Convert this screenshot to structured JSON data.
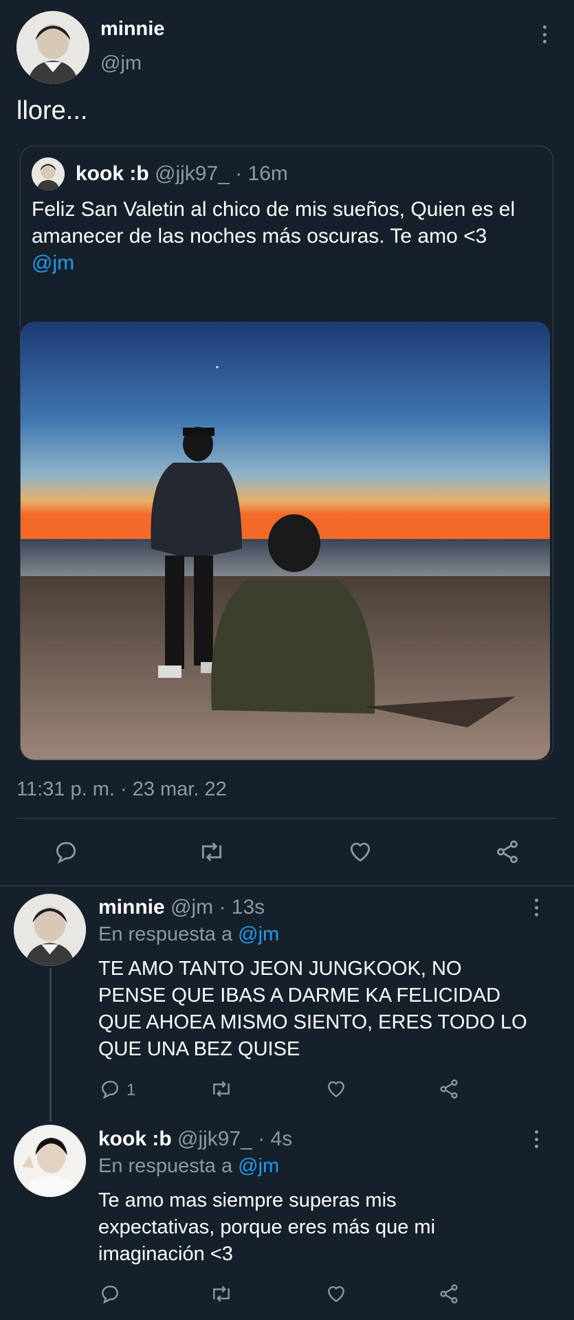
{
  "main_tweet": {
    "author_name": "minnie",
    "author_handle": "@jm",
    "text": "llore...",
    "timestamp": "11:31 p. m. · 23 mar. 22"
  },
  "quoted_tweet": {
    "author_name": "kook :b",
    "author_handle": "@jjk97_",
    "time": "· 16m",
    "text": "Feliz San Valetin al chico de mis sueños, Quien es el amanecer de las noches más oscuras. Te amo <3",
    "mention": "@jm"
  },
  "actions": {
    "reply_icon": "reply-icon",
    "retweet_icon": "retweet-icon",
    "like_icon": "heart-icon",
    "share_icon": "share-icon"
  },
  "replies": [
    {
      "author_name": "minnie",
      "author_handle": "@jm · 13s",
      "reply_label": "En respuesta a",
      "reply_to": "@jm",
      "text": "TE AMO TANTO JEON JUNGKOOK, NO PENSE QUE IBAS A DARME KA FELICIDAD QUE AHOEA MISMO SIENTO, ERES TODO LO QUE UNA BEZ QUISE",
      "reply_count": "1"
    },
    {
      "author_name": "kook :b",
      "author_handle": "@jjk97_ · 4s",
      "reply_label": "En respuesta a",
      "reply_to": "@jm",
      "text": "Te amo mas siempre superas mis expectativas, porque eres más que mi imaginación <3",
      "reply_count": ""
    }
  ],
  "colors": {
    "background": "#15202b",
    "accent": "#1d9bf0",
    "secondary_text": "#8b98a5",
    "divider": "#38444d"
  }
}
